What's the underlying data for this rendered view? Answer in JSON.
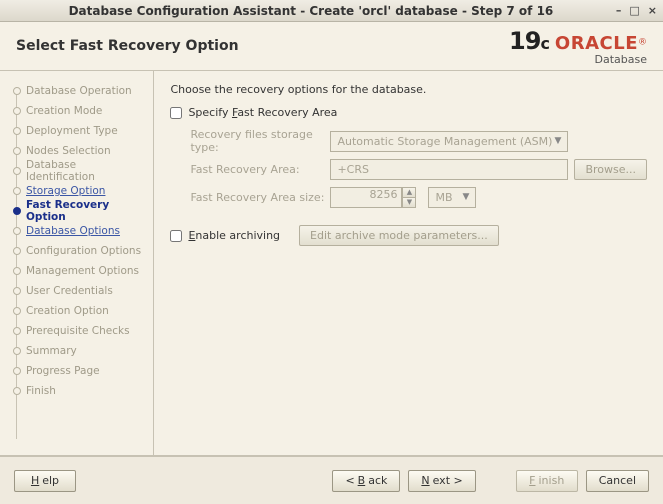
{
  "window": {
    "title": "Database Configuration Assistant - Create 'orcl' database - Step 7 of 16"
  },
  "header": {
    "page_title": "Select Fast Recovery Option",
    "brand_version": "19",
    "brand_version_suffix": "c",
    "brand_name": "ORACLE",
    "brand_sub": "Database"
  },
  "sidebar": {
    "items": [
      {
        "label": "Database Operation",
        "state": "pending"
      },
      {
        "label": "Creation Mode",
        "state": "pending"
      },
      {
        "label": "Deployment Type",
        "state": "pending"
      },
      {
        "label": "Nodes Selection",
        "state": "pending"
      },
      {
        "label": "Database Identification",
        "state": "pending"
      },
      {
        "label": "Storage Option",
        "state": "done"
      },
      {
        "label": "Fast Recovery Option",
        "state": "current"
      },
      {
        "label": "Database Options",
        "state": "next"
      },
      {
        "label": "Configuration Options",
        "state": "pending"
      },
      {
        "label": "Management Options",
        "state": "pending"
      },
      {
        "label": "User Credentials",
        "state": "pending"
      },
      {
        "label": "Creation Option",
        "state": "pending"
      },
      {
        "label": "Prerequisite Checks",
        "state": "pending"
      },
      {
        "label": "Summary",
        "state": "pending"
      },
      {
        "label": "Progress Page",
        "state": "pending"
      },
      {
        "label": "Finish",
        "state": "pending"
      }
    ]
  },
  "content": {
    "intro": "Choose the recovery options for the database.",
    "specify_fra_prefix": "Specify ",
    "specify_fra_mnemonic": "F",
    "specify_fra_suffix": "ast Recovery Area",
    "storage_type_label": "Recovery files storage type:",
    "storage_type_value": "Automatic Storage Management (ASM)",
    "fra_label": "Fast Recovery Area:",
    "fra_value": "+CRS",
    "browse_label": "Browse...",
    "fra_size_label": "Fast Recovery Area size:",
    "fra_size_value": "8256",
    "fra_size_unit": "MB",
    "enable_archiving_mnemonic": "E",
    "enable_archiving_suffix": "nable archiving",
    "edit_archive_label": "Edit archive mode parameters..."
  },
  "footer": {
    "help": "Help",
    "back": "Back",
    "next": "Next",
    "finish": "Finish",
    "cancel": "Cancel"
  }
}
